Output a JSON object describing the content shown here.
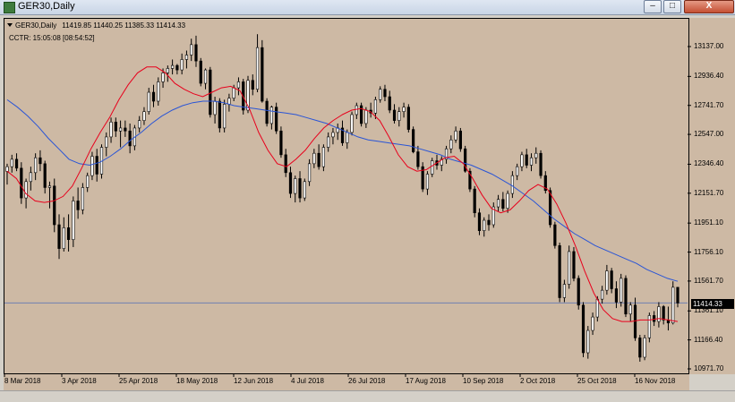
{
  "window": {
    "title": "GER30,Daily",
    "min_glyph": "–",
    "max_glyph": "□",
    "close_glyph": "X"
  },
  "chart": {
    "symbol_line": "GER30,Daily",
    "ohlc": "11419.85 11440.25 11385.33 11414.33",
    "countdown": "CCTR: 15:05:08 [08:54:52]",
    "current_price": "11414.33",
    "background_color": "#cdb9a4",
    "candle_color": "#000000",
    "ma_fast_color": "#e8001c",
    "ma_slow_color": "#2a55d6",
    "price_line_color": "#6f7faf"
  },
  "price_axis": {
    "labels": [
      "13137.00",
      "12936.40",
      "12741.70",
      "12547.00",
      "12346.40",
      "12151.70",
      "11951.10",
      "11756.10",
      "11561.70",
      "11361.10",
      "11166.40",
      "10971.70"
    ]
  },
  "time_axis": {
    "labels": [
      "8 Mar 2018",
      "3 Apr 2018",
      "25 Apr 2018",
      "18 May 2018",
      "12 Jun 2018",
      "4 Jul 2018",
      "26 Jul 2018",
      "17 Aug 2018",
      "10 Sep 2018",
      "2 Oct 2018",
      "25 Oct 2018",
      "16 Nov 2018"
    ]
  },
  "chart_data": {
    "type": "candlestick",
    "title": "GER30,Daily",
    "ylim": [
      10930,
      13250
    ],
    "grid": false,
    "series": [
      {
        "name": "GER30",
        "ohlc": [
          [
            12298,
            12350,
            12210,
            12330
          ],
          [
            12330,
            12410,
            12290,
            12380
          ],
          [
            12380,
            12420,
            12300,
            12320
          ],
          [
            12320,
            12360,
            12080,
            12120
          ],
          [
            12120,
            12250,
            12050,
            12230
          ],
          [
            12230,
            12330,
            12170,
            12290
          ],
          [
            12290,
            12420,
            12240,
            12390
          ],
          [
            12390,
            12440,
            12300,
            12350
          ],
          [
            12350,
            12370,
            12150,
            12190
          ],
          [
            12190,
            12230,
            12050,
            12200
          ],
          [
            12200,
            12250,
            11890,
            11940
          ],
          [
            11940,
            12010,
            11710,
            11780
          ],
          [
            11780,
            11990,
            11760,
            11920
          ],
          [
            11920,
            12010,
            11760,
            11840
          ],
          [
            11840,
            12130,
            11790,
            12100
          ],
          [
            12100,
            12190,
            11980,
            12040
          ],
          [
            12040,
            12220,
            12010,
            12190
          ],
          [
            12190,
            12290,
            12160,
            12270
          ],
          [
            12270,
            12430,
            12240,
            12400
          ],
          [
            12400,
            12450,
            12230,
            12280
          ],
          [
            12280,
            12480,
            12250,
            12460
          ],
          [
            12460,
            12560,
            12400,
            12530
          ],
          [
            12530,
            12660,
            12490,
            12630
          ],
          [
            12630,
            12660,
            12530,
            12570
          ],
          [
            12570,
            12640,
            12460,
            12590
          ],
          [
            12590,
            12640,
            12530,
            12570
          ],
          [
            12570,
            12620,
            12420,
            12470
          ],
          [
            12470,
            12610,
            12440,
            12590
          ],
          [
            12590,
            12670,
            12560,
            12640
          ],
          [
            12640,
            12730,
            12610,
            12700
          ],
          [
            12700,
            12860,
            12680,
            12830
          ],
          [
            12830,
            12880,
            12730,
            12770
          ],
          [
            12770,
            12930,
            12740,
            12900
          ],
          [
            12900,
            12990,
            12860,
            12960
          ],
          [
            12960,
            13010,
            12900,
            12990
          ],
          [
            12990,
            13050,
            12950,
            13010
          ],
          [
            13010,
            13020,
            12950,
            12980
          ],
          [
            12980,
            13090,
            12950,
            13050
          ],
          [
            13050,
            13110,
            12990,
            13080
          ],
          [
            13080,
            13190,
            13040,
            13150
          ],
          [
            13150,
            13210,
            13000,
            13040
          ],
          [
            13040,
            13060,
            12870,
            12890
          ],
          [
            12890,
            12990,
            12850,
            12980
          ],
          [
            12980,
            13000,
            12660,
            12680
          ],
          [
            12680,
            12800,
            12620,
            12770
          ],
          [
            12770,
            12790,
            12560,
            12590
          ],
          [
            12590,
            12780,
            12560,
            12750
          ],
          [
            12750,
            12820,
            12700,
            12790
          ],
          [
            12790,
            12880,
            12770,
            12860
          ],
          [
            12860,
            12930,
            12810,
            12900
          ],
          [
            12900,
            12920,
            12680,
            12710
          ],
          [
            12710,
            12940,
            12690,
            12910
          ],
          [
            12910,
            12950,
            12810,
            12850
          ],
          [
            12850,
            13220,
            12830,
            13130
          ],
          [
            13130,
            13180,
            12760,
            12770
          ],
          [
            12770,
            12790,
            12600,
            12620
          ],
          [
            12620,
            12740,
            12580,
            12730
          ],
          [
            12730,
            12760,
            12550,
            12570
          ],
          [
            12570,
            12600,
            12390,
            12410
          ],
          [
            12410,
            12450,
            12260,
            12290
          ],
          [
            12290,
            12330,
            12120,
            12150
          ],
          [
            12150,
            12270,
            12090,
            12250
          ],
          [
            12250,
            12300,
            12090,
            12120
          ],
          [
            12120,
            12250,
            12100,
            12230
          ],
          [
            12230,
            12380,
            12200,
            12350
          ],
          [
            12350,
            12450,
            12320,
            12420
          ],
          [
            12420,
            12480,
            12310,
            12330
          ],
          [
            12330,
            12480,
            12300,
            12460
          ],
          [
            12460,
            12560,
            12430,
            12530
          ],
          [
            12530,
            12590,
            12480,
            12560
          ],
          [
            12560,
            12620,
            12510,
            12590
          ],
          [
            12590,
            12640,
            12470,
            12490
          ],
          [
            12490,
            12580,
            12450,
            12560
          ],
          [
            12560,
            12700,
            12540,
            12680
          ],
          [
            12680,
            12760,
            12650,
            12740
          ],
          [
            12740,
            12760,
            12600,
            12620
          ],
          [
            12620,
            12730,
            12590,
            12710
          ],
          [
            12710,
            12760,
            12660,
            12690
          ],
          [
            12690,
            12800,
            12650,
            12780
          ],
          [
            12780,
            12870,
            12760,
            12850
          ],
          [
            12850,
            12880,
            12770,
            12800
          ],
          [
            12800,
            12840,
            12690,
            12710
          ],
          [
            12710,
            12750,
            12620,
            12640
          ],
          [
            12640,
            12730,
            12600,
            12700
          ],
          [
            12700,
            12760,
            12660,
            12730
          ],
          [
            12730,
            12750,
            12560,
            12580
          ],
          [
            12580,
            12600,
            12420,
            12430
          ],
          [
            12430,
            12470,
            12310,
            12330
          ],
          [
            12330,
            12360,
            12160,
            12180
          ],
          [
            12180,
            12300,
            12140,
            12280
          ],
          [
            12280,
            12390,
            12260,
            12370
          ],
          [
            12370,
            12410,
            12310,
            12340
          ],
          [
            12340,
            12400,
            12300,
            12380
          ],
          [
            12380,
            12470,
            12350,
            12450
          ],
          [
            12450,
            12540,
            12420,
            12510
          ],
          [
            12510,
            12600,
            12490,
            12570
          ],
          [
            12570,
            12590,
            12430,
            12450
          ],
          [
            12450,
            12470,
            12290,
            12300
          ],
          [
            12300,
            12320,
            12160,
            12180
          ],
          [
            12180,
            12200,
            11990,
            12020
          ],
          [
            12020,
            12050,
            11870,
            11900
          ],
          [
            11900,
            11990,
            11860,
            11970
          ],
          [
            11970,
            12010,
            11900,
            11940
          ],
          [
            11940,
            12090,
            11920,
            12060
          ],
          [
            12060,
            12140,
            12030,
            12110
          ],
          [
            12110,
            12160,
            12030,
            12050
          ],
          [
            12050,
            12170,
            12020,
            12150
          ],
          [
            12150,
            12300,
            12120,
            12270
          ],
          [
            12270,
            12350,
            12240,
            12330
          ],
          [
            12330,
            12430,
            12300,
            12410
          ],
          [
            12410,
            12450,
            12320,
            12340
          ],
          [
            12340,
            12420,
            12300,
            12390
          ],
          [
            12390,
            12460,
            12350,
            12420
          ],
          [
            12420,
            12440,
            12250,
            12270
          ],
          [
            12270,
            12300,
            12150,
            12170
          ],
          [
            12170,
            12190,
            11920,
            11940
          ],
          [
            11940,
            11960,
            11780,
            11800
          ],
          [
            11800,
            11820,
            11420,
            11450
          ],
          [
            11450,
            11570,
            11420,
            11540
          ],
          [
            11540,
            11800,
            11510,
            11760
          ],
          [
            11760,
            11790,
            11560,
            11580
          ],
          [
            11580,
            11600,
            11370,
            11400
          ],
          [
            11400,
            11420,
            11050,
            11080
          ],
          [
            11080,
            11260,
            11040,
            11230
          ],
          [
            11230,
            11350,
            11200,
            11320
          ],
          [
            11320,
            11460,
            11290,
            11440
          ],
          [
            11440,
            11530,
            11410,
            11500
          ],
          [
            11500,
            11670,
            11470,
            11630
          ],
          [
            11630,
            11650,
            11480,
            11510
          ],
          [
            11510,
            11560,
            11380,
            11420
          ],
          [
            11420,
            11610,
            11390,
            11580
          ],
          [
            11580,
            11600,
            11320,
            11340
          ],
          [
            11340,
            11420,
            11290,
            11400
          ],
          [
            11400,
            11450,
            11160,
            11180
          ],
          [
            11180,
            11200,
            11020,
            11050
          ],
          [
            11050,
            11200,
            11030,
            11180
          ],
          [
            11180,
            11350,
            11150,
            11330
          ],
          [
            11330,
            11360,
            11260,
            11290
          ],
          [
            11290,
            11420,
            11250,
            11390
          ],
          [
            11390,
            11400,
            11270,
            11300
          ],
          [
            11300,
            11390,
            11230,
            11280
          ],
          [
            11280,
            11560,
            11270,
            11520
          ],
          [
            11520,
            11440,
            11385,
            11414
          ]
        ]
      },
      {
        "name": "MA fast",
        "values": [
          12300,
          12250,
          12150,
          12100,
          12090,
          12100,
          12130,
          12200,
          12320,
          12450,
          12560,
          12660,
          12780,
          12880,
          12960,
          13000,
          13000,
          12960,
          12890,
          12850,
          12820,
          12800,
          12830,
          12860,
          12870,
          12840,
          12720,
          12560,
          12440,
          12350,
          12330,
          12380,
          12440,
          12520,
          12590,
          12640,
          12680,
          12710,
          12720,
          12700,
          12640,
          12530,
          12410,
          12330,
          12300,
          12310,
          12350,
          12390,
          12400,
          12350,
          12250,
          12140,
          12050,
          12020,
          12040,
          12100,
          12170,
          12210,
          12180,
          12080,
          11950,
          11800,
          11630,
          11480,
          11370,
          11310,
          11290,
          11290,
          11300,
          11300,
          11310,
          11300,
          11290
        ]
      },
      {
        "name": "MA slow",
        "values": [
          12780,
          12730,
          12670,
          12600,
          12520,
          12450,
          12380,
          12350,
          12340,
          12360,
          12400,
          12450,
          12510,
          12560,
          12620,
          12670,
          12710,
          12740,
          12760,
          12770,
          12770,
          12760,
          12740,
          12730,
          12720,
          12710,
          12700,
          12690,
          12680,
          12660,
          12640,
          12620,
          12590,
          12560,
          12530,
          12510,
          12500,
          12490,
          12480,
          12470,
          12450,
          12430,
          12410,
          12380,
          12360,
          12340,
          12310,
          12280,
          12240,
          12200,
          12150,
          12100,
          12040,
          11980,
          11930,
          11880,
          11840,
          11800,
          11770,
          11740,
          11710,
          11680,
          11640,
          11610,
          11580,
          11560
        ]
      }
    ],
    "current_price": 11414.33,
    "y_ticks": [
      13137.0,
      12936.4,
      12741.7,
      12547.0,
      12346.4,
      12151.7,
      11951.1,
      11756.1,
      11561.7,
      11361.1,
      11166.4,
      10971.7
    ],
    "x_ticks": [
      "8 Mar 2018",
      "3 Apr 2018",
      "25 Apr 2018",
      "18 May 2018",
      "12 Jun 2018",
      "4 Jul 2018",
      "26 Jul 2018",
      "17 Aug 2018",
      "10 Sep 2018",
      "2 Oct 2018",
      "25 Oct 2018",
      "16 Nov 2018"
    ]
  }
}
